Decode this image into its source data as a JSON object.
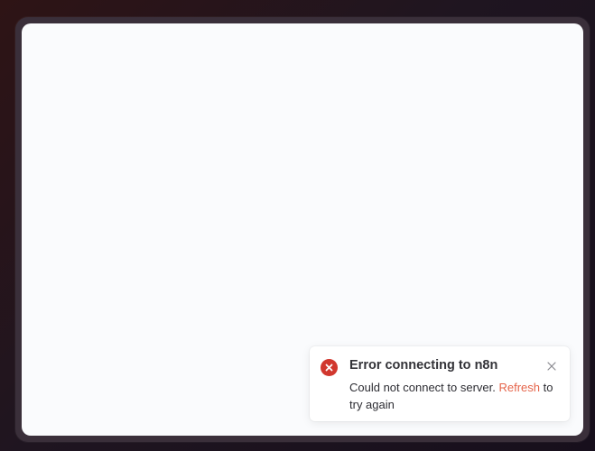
{
  "toast": {
    "icon": "error-circle-icon",
    "title": "Error connecting to n8n",
    "message_prefix": "Could not connect to server.",
    "link_label": "Refresh",
    "message_suffix": "to try again",
    "close_icon": "close-icon"
  },
  "colors": {
    "error": "#d1372e",
    "link": "#e5644a",
    "canvas": "#fafbfd",
    "frame": "#3a2f3a"
  }
}
